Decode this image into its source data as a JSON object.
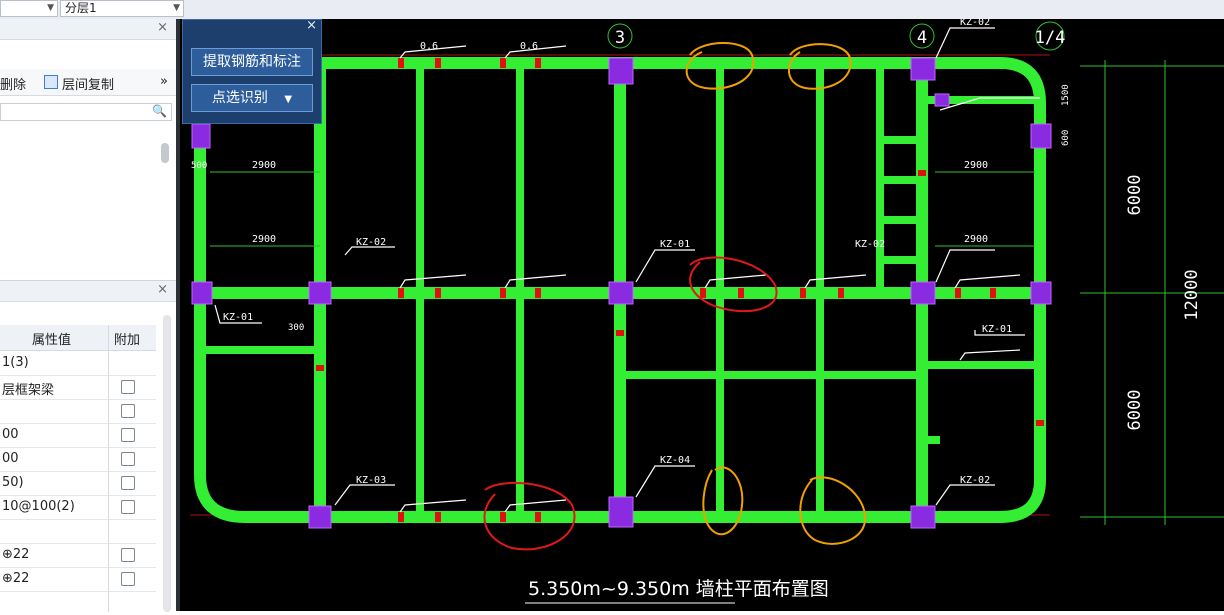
{
  "topbar": {
    "dropdown1": "",
    "dropdown2": "分层1"
  },
  "left_panel": {
    "toolbar": {
      "delete_label": "删除",
      "copy_floor_label": "层间复制",
      "more": "»"
    }
  },
  "properties": {
    "col_value": "属性值",
    "col_extra": "附加",
    "rows": [
      {
        "value": "1(3)",
        "checkbox": false
      },
      {
        "value": "层框架梁",
        "checkbox": true
      },
      {
        "value": "",
        "checkbox": true
      },
      {
        "value": "00",
        "checkbox": true
      },
      {
        "value": "00",
        "checkbox": true
      },
      {
        "value": "50)",
        "checkbox": true
      },
      {
        "value": "10@100(2)",
        "checkbox": true
      },
      {
        "value": "",
        "checkbox": false
      },
      {
        "value": "⊕22",
        "checkbox": true
      },
      {
        "value": "⊕22",
        "checkbox": true
      }
    ]
  },
  "float_panel": {
    "extract_button": "提取钢筋和标注",
    "recognize_button": "点选识别",
    "close": "×"
  },
  "drawing": {
    "axis_labels": [
      "3",
      "4",
      "1/4"
    ],
    "column_tags": [
      "KZ-01",
      "KZ-02",
      "KZ-03",
      "KZ-04",
      "KZ-01",
      "KZ-02",
      "KZ-02",
      "KZ-01",
      "KZ-02"
    ],
    "dimensions": [
      "6000",
      "6000",
      "12000",
      "2900",
      "2900",
      "2900",
      "2900",
      "300",
      "500",
      "1500",
      "600"
    ],
    "beam_labels": [
      "0.6",
      "0.6"
    ],
    "title": "5.350m~9.350m 墙柱平面布置图"
  }
}
